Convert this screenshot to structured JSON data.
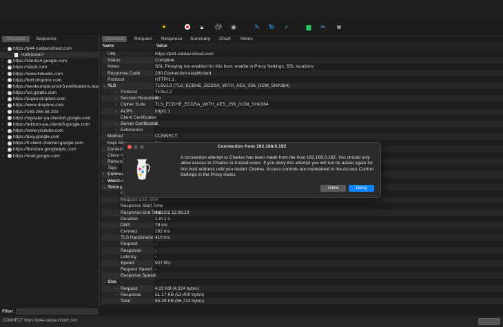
{
  "toolbar": {
    "icons": [
      "broom-icon",
      "record-icon",
      "lock-icon",
      "turtle-icon",
      "breakpoint-icon",
      "pen-icon",
      "refresh-icon",
      "check-icon",
      "basket-icon",
      "tools-icon",
      "settings-icon"
    ]
  },
  "left": {
    "tabs": [
      "Structure",
      "Sequence"
    ],
    "items": [
      {
        "label": "https://p44-caldav.icloud.com",
        "expanded": true
      },
      {
        "label": "<unknown>",
        "child": true
      },
      {
        "label": "https://clients4.google.com"
      },
      {
        "label": "https://slack.com"
      },
      {
        "label": "https://www.linkedin.com"
      },
      {
        "label": "https://bolt.dropbox.com"
      },
      {
        "label": "https://westeurope-prod-3.notifications.teams"
      },
      {
        "label": "https://ssl.gstatic.com"
      },
      {
        "label": "https://paper.dropbox.com"
      },
      {
        "label": "https://www.dropbox.com"
      },
      {
        "label": "https://169.255.56.203"
      },
      {
        "label": "https://signaler-pa.clients6.google.com"
      },
      {
        "label": "https://addons-pa.clients6.google.com"
      },
      {
        "label": "https://www.youtube.com"
      },
      {
        "label": "https://play.google.com"
      },
      {
        "label": "https://0.client-channel.google.com"
      },
      {
        "label": "https://firestore.googleapis.com"
      },
      {
        "label": "https://mail.google.com"
      }
    ],
    "filter_label": "Filter:",
    "filter_value": ""
  },
  "main": {
    "tabs": [
      "Overview",
      "Request",
      "Response",
      "Summary",
      "Chart",
      "Notes"
    ],
    "columns": [
      "Name",
      "Value"
    ],
    "rows": [
      {
        "n": "URL",
        "v": "https://p44-caldav.icloud.com",
        "l": 1
      },
      {
        "n": "Status",
        "v": "Complete",
        "l": 1
      },
      {
        "n": "Notes",
        "v": "SSL Proxying not enabled for this host: enable in Proxy Settings, SSL locations",
        "l": 1
      },
      {
        "n": "Response Code",
        "v": "200 Connection established",
        "l": 1
      },
      {
        "n": "Protocol",
        "v": "HTTP/1.1",
        "l": 1
      },
      {
        "n": "TLS",
        "v": "TLSv1.2 (TLS_ECDHE_ECDSA_WITH_AES_256_GCM_SHA384)",
        "l": 0,
        "g": "open"
      },
      {
        "n": "Protocol",
        "v": "TLSv1.2",
        "l": 2,
        "g": "closed"
      },
      {
        "n": "Session Resumed",
        "v": "No",
        "l": 2,
        "g": "closed"
      },
      {
        "n": "Cipher Suite",
        "v": "TLS_ECDHE_ECDSA_WITH_AES_256_GCM_SHA384",
        "l": 2,
        "g": "closed"
      },
      {
        "n": "ALPN",
        "v": "http/1.1",
        "l": 2,
        "g": "closed"
      },
      {
        "n": "Client Certificates",
        "v": "-",
        "l": 2
      },
      {
        "n": "Server Certificates",
        "v": "3",
        "l": 2,
        "g": "closed"
      },
      {
        "n": "Extensions",
        "v": "",
        "l": 2,
        "g": "closed"
      },
      {
        "n": "Method",
        "v": "CONNECT",
        "l": 1
      },
      {
        "n": "Kept Alive",
        "v": "No",
        "l": 1
      },
      {
        "n": "Content",
        "v": "",
        "l": 1
      },
      {
        "n": "Client A",
        "v": "",
        "l": 1
      },
      {
        "n": "Remote",
        "v": "",
        "l": 1
      },
      {
        "n": "Tags",
        "v": "",
        "l": 1
      },
      {
        "n": "Connec",
        "v": "",
        "l": 0,
        "g": "closed"
      },
      {
        "n": "WebSo",
        "v": "",
        "l": 0,
        "g": "closed"
      },
      {
        "n": "Timing",
        "v": "",
        "l": 0,
        "g": "open"
      },
      {
        "n": "Req",
        "v": "",
        "l": 2
      },
      {
        "n": "Request End Time",
        "v": "",
        "l": 2
      },
      {
        "n": "Response Start Time",
        "v": "-",
        "l": 2
      },
      {
        "n": "Response End Time",
        "v": "4/22/22 12:36:19",
        "l": 2
      },
      {
        "n": "Duration",
        "v": "1 m 1 s",
        "l": 2
      },
      {
        "n": "DNS",
        "v": "78 ms",
        "l": 2
      },
      {
        "n": "Connect",
        "v": "202 ms",
        "l": 2
      },
      {
        "n": "TLS Handshake",
        "v": "410 ms",
        "l": 2
      },
      {
        "n": "Request",
        "v": "-",
        "l": 2
      },
      {
        "n": "Response",
        "v": "-",
        "l": 2
      },
      {
        "n": "Latency",
        "v": "-",
        "l": 2
      },
      {
        "n": "Speed",
        "v": "927 B/s",
        "l": 2
      },
      {
        "n": "Request Speed",
        "v": "-",
        "l": 2
      },
      {
        "n": "Response Speed",
        "v": "-",
        "l": 2
      },
      {
        "n": "Size",
        "v": "",
        "l": 0,
        "g": "open"
      },
      {
        "n": "Request",
        "v": "4.22 KB (4,324 bytes)",
        "l": 2,
        "g": "closed"
      },
      {
        "n": "Response",
        "v": "51.17 KB (52,400 bytes)",
        "l": 2,
        "g": "closed"
      },
      {
        "n": "Total",
        "v": "55.39 KB (56,724 bytes)",
        "l": 2
      }
    ]
  },
  "dialog": {
    "title": "Connection from 192.168.0.192",
    "message": "A connection attempt to Charles has been made from the host 192.168.0.192. You should only allow access to Charles to trusted users. If you deny this attempt you will not be asked again for this host address until you restart Charles. Access controls are maintained in the Access Control Settings in the Proxy menu.",
    "allow": "Allow",
    "deny": "Deny",
    "accent": "#0a84ff"
  },
  "status": {
    "text": "CONNECT https://p44-caldav.icloud.com"
  }
}
